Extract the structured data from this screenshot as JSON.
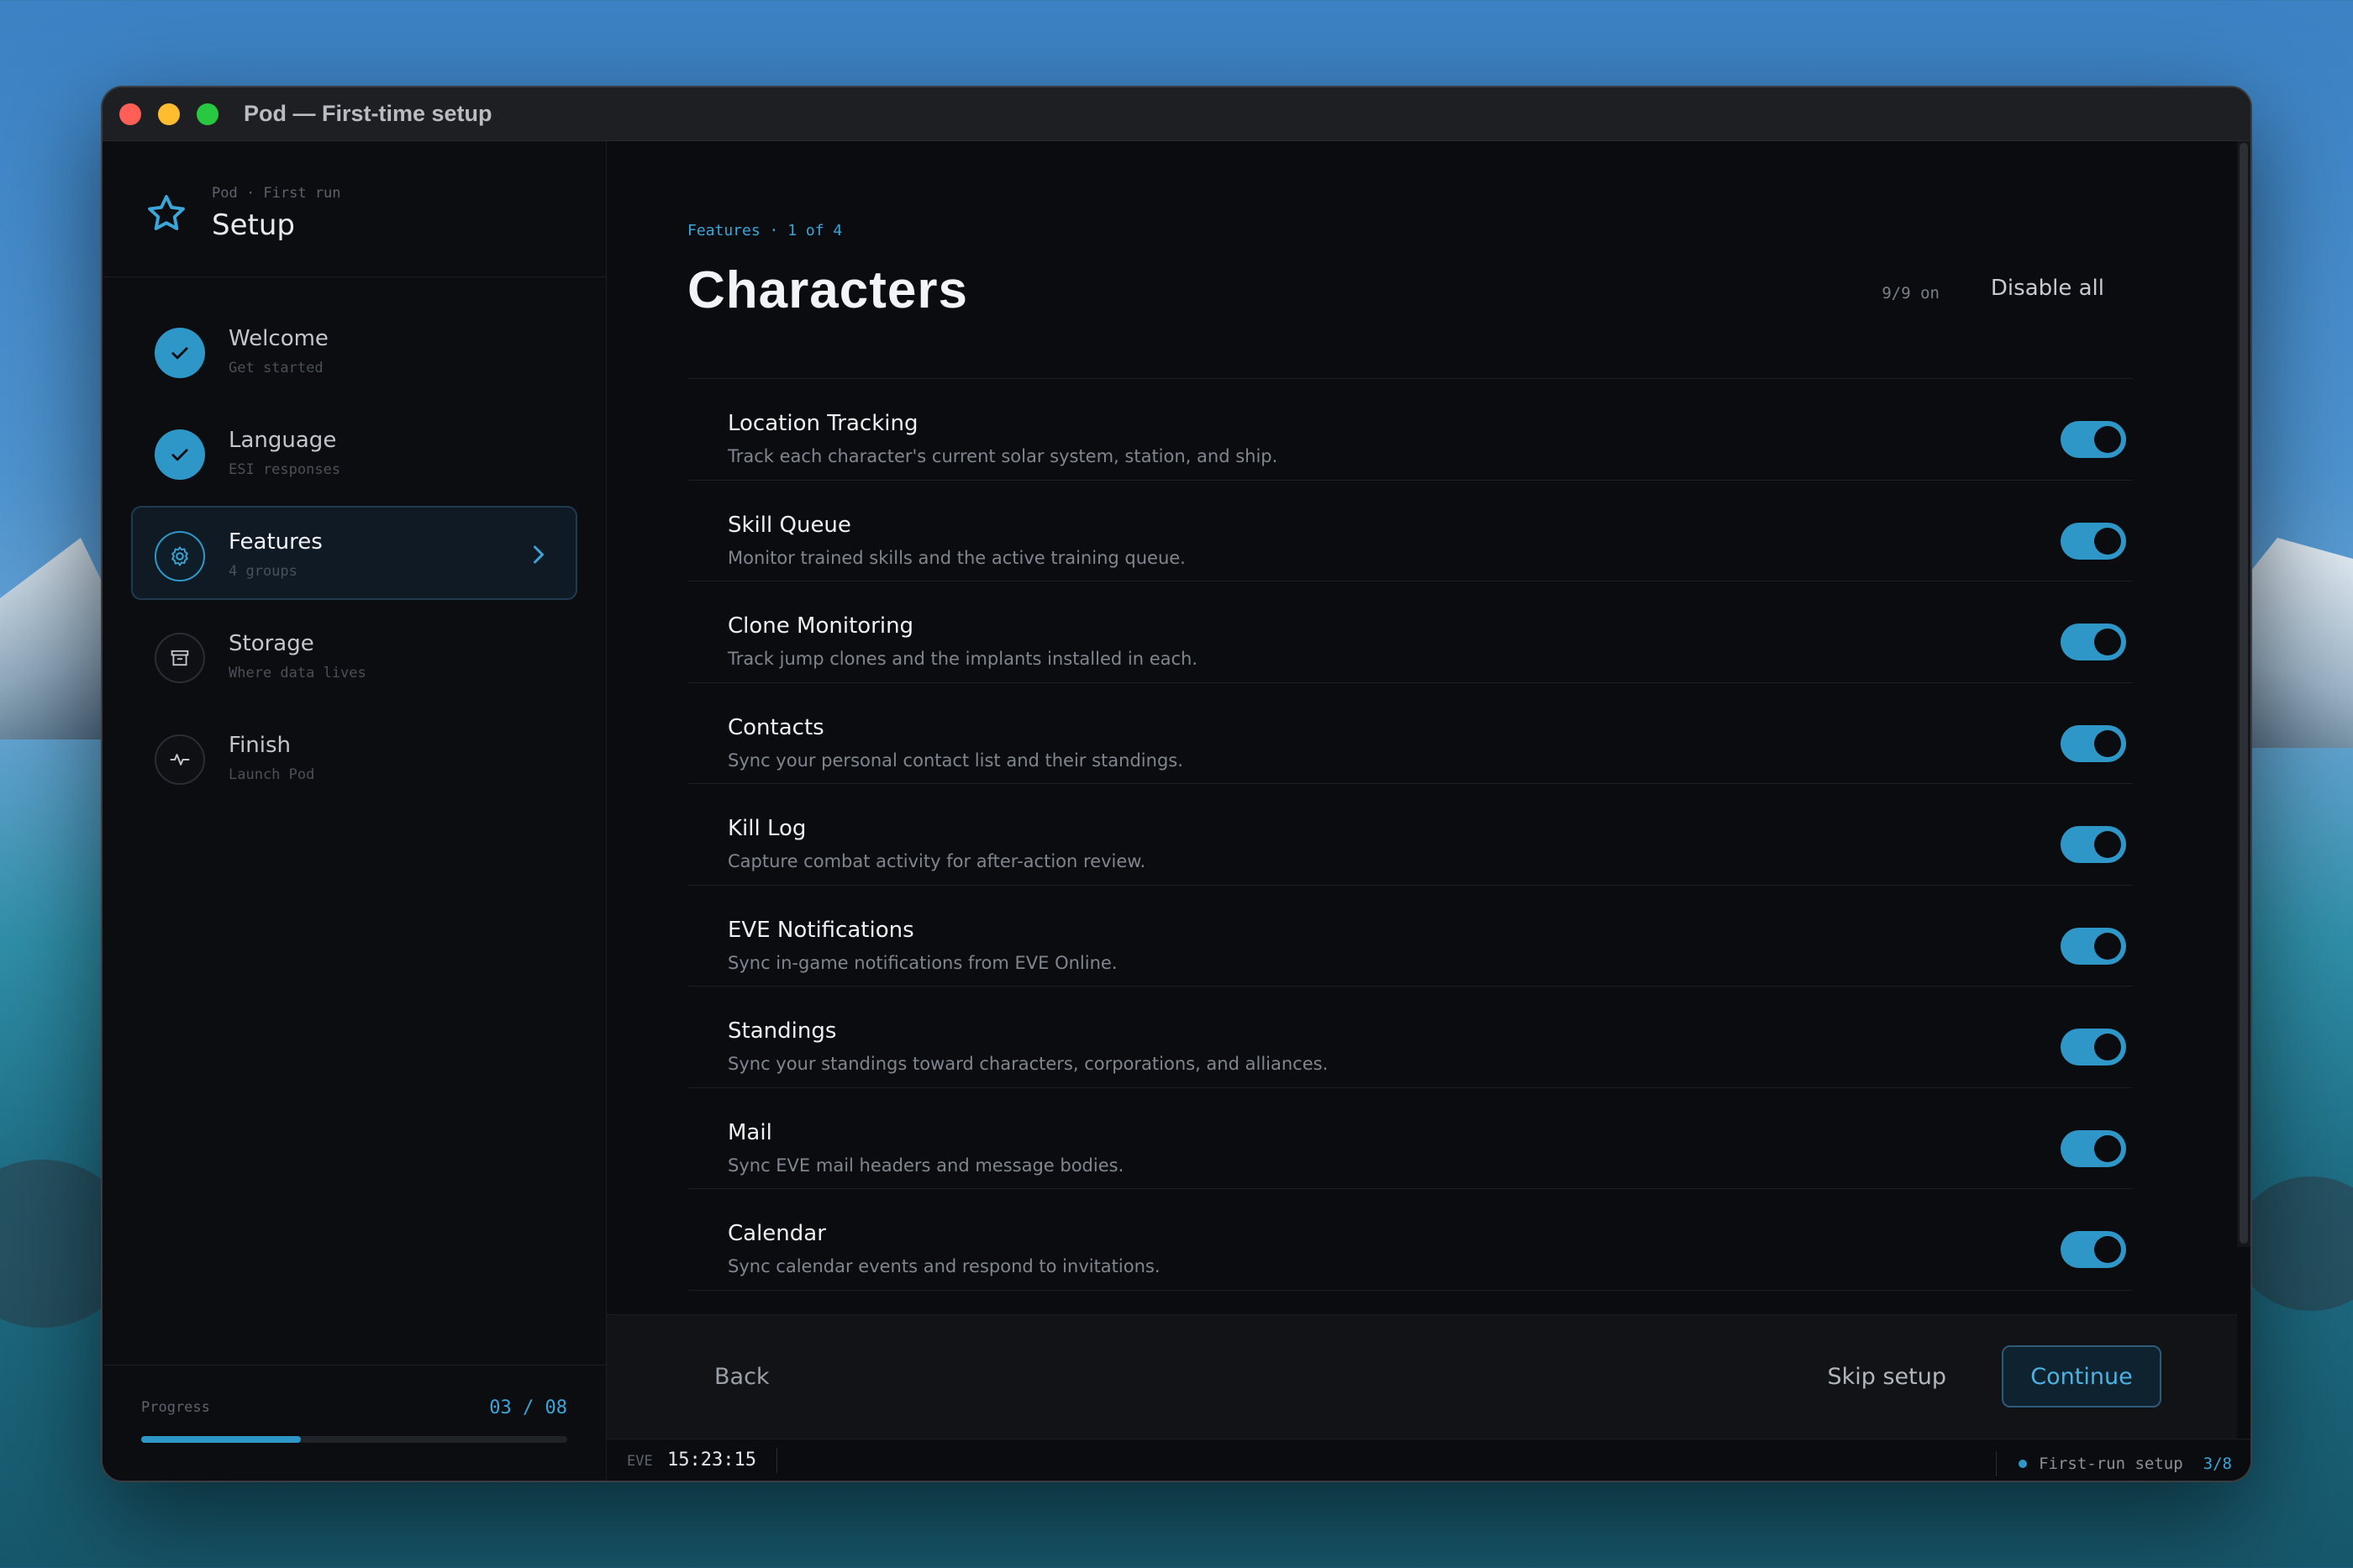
{
  "window": {
    "title": "Pod — First-time setup"
  },
  "brand": {
    "crumb": "Pod · First run",
    "title": "Setup"
  },
  "steps": [
    {
      "label": "Welcome",
      "sub": "Get started",
      "state": "done",
      "icon": "check-icon"
    },
    {
      "label": "Language",
      "sub": "ESI responses",
      "state": "done",
      "icon": "check-icon"
    },
    {
      "label": "Features",
      "sub": "4 groups",
      "state": "current",
      "icon": "gear-icon"
    },
    {
      "label": "Storage",
      "sub": "Where data lives",
      "state": "todo",
      "icon": "archive-icon"
    },
    {
      "label": "Finish",
      "sub": "Launch Pod",
      "state": "todo",
      "icon": "pulse-icon"
    }
  ],
  "progress": {
    "label": "Progress",
    "count": "03 / 08",
    "fraction": 0.375
  },
  "page": {
    "crumb": "Features · 1 of 4",
    "title": "Characters",
    "count_on": "9/9 on",
    "disable_all": "Disable all"
  },
  "features": [
    {
      "name": "Location Tracking",
      "desc": "Track each character's current solar system, station, and ship.",
      "enabled": true
    },
    {
      "name": "Skill Queue",
      "desc": "Monitor trained skills and the active training queue.",
      "enabled": true
    },
    {
      "name": "Clone Monitoring",
      "desc": "Track jump clones and the implants installed in each.",
      "enabled": true
    },
    {
      "name": "Contacts",
      "desc": "Sync your personal contact list and their standings.",
      "enabled": true
    },
    {
      "name": "Kill Log",
      "desc": "Capture combat activity for after-action review.",
      "enabled": true
    },
    {
      "name": "EVE Notifications",
      "desc": "Sync in-game notifications from EVE Online.",
      "enabled": true
    },
    {
      "name": "Standings",
      "desc": "Sync your standings toward characters, corporations, and alliances.",
      "enabled": true
    },
    {
      "name": "Mail",
      "desc": "Sync EVE mail headers and message bodies.",
      "enabled": true
    },
    {
      "name": "Calendar",
      "desc": "Sync calendar events and respond to invitations.",
      "enabled": true
    }
  ],
  "footer": {
    "back": "Back",
    "skip": "Skip setup",
    "continue": "Continue"
  },
  "statusbar": {
    "eve_label": "EVE",
    "time": "15:23:15",
    "label": "First-run setup",
    "count": "3/8"
  },
  "colors": {
    "accent": "#2f97c8",
    "background": "#0b0c0f"
  }
}
